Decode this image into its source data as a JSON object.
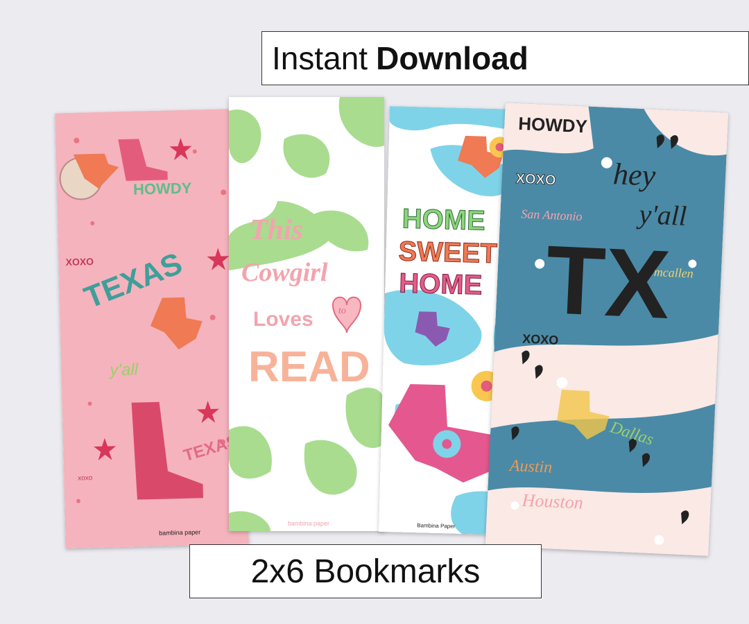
{
  "header": {
    "line1_regular": "Instant",
    "line1_bold": "Download"
  },
  "footer": {
    "label": "2x6 Bookmarks"
  },
  "bookmarks": [
    {
      "words": [
        "HOWDY",
        "TEXAS",
        "XOXO",
        "y'all",
        "TEXAS",
        "xoxo"
      ],
      "credit": "bambina paper"
    },
    {
      "words": [
        "This",
        "Cowgirl",
        "Loves",
        "to",
        "READ"
      ],
      "credit": "bambina paper"
    },
    {
      "words": [
        "HOME",
        "SWEET",
        "HOME"
      ],
      "credit": "Bambina Paper"
    },
    {
      "words": [
        "HOWDY",
        "XOXO",
        "hey",
        "y'all",
        "San Antonio",
        "TX",
        "mcallen",
        "XOXO",
        "Dallas",
        "Austin",
        "Houston"
      ],
      "credit": ""
    }
  ],
  "colors": {
    "bg": "#ecebf0",
    "pink": "#f2a9b4",
    "green": "#a8d98c",
    "blue": "#7fd3e8",
    "teal": "#4a8aa6"
  }
}
